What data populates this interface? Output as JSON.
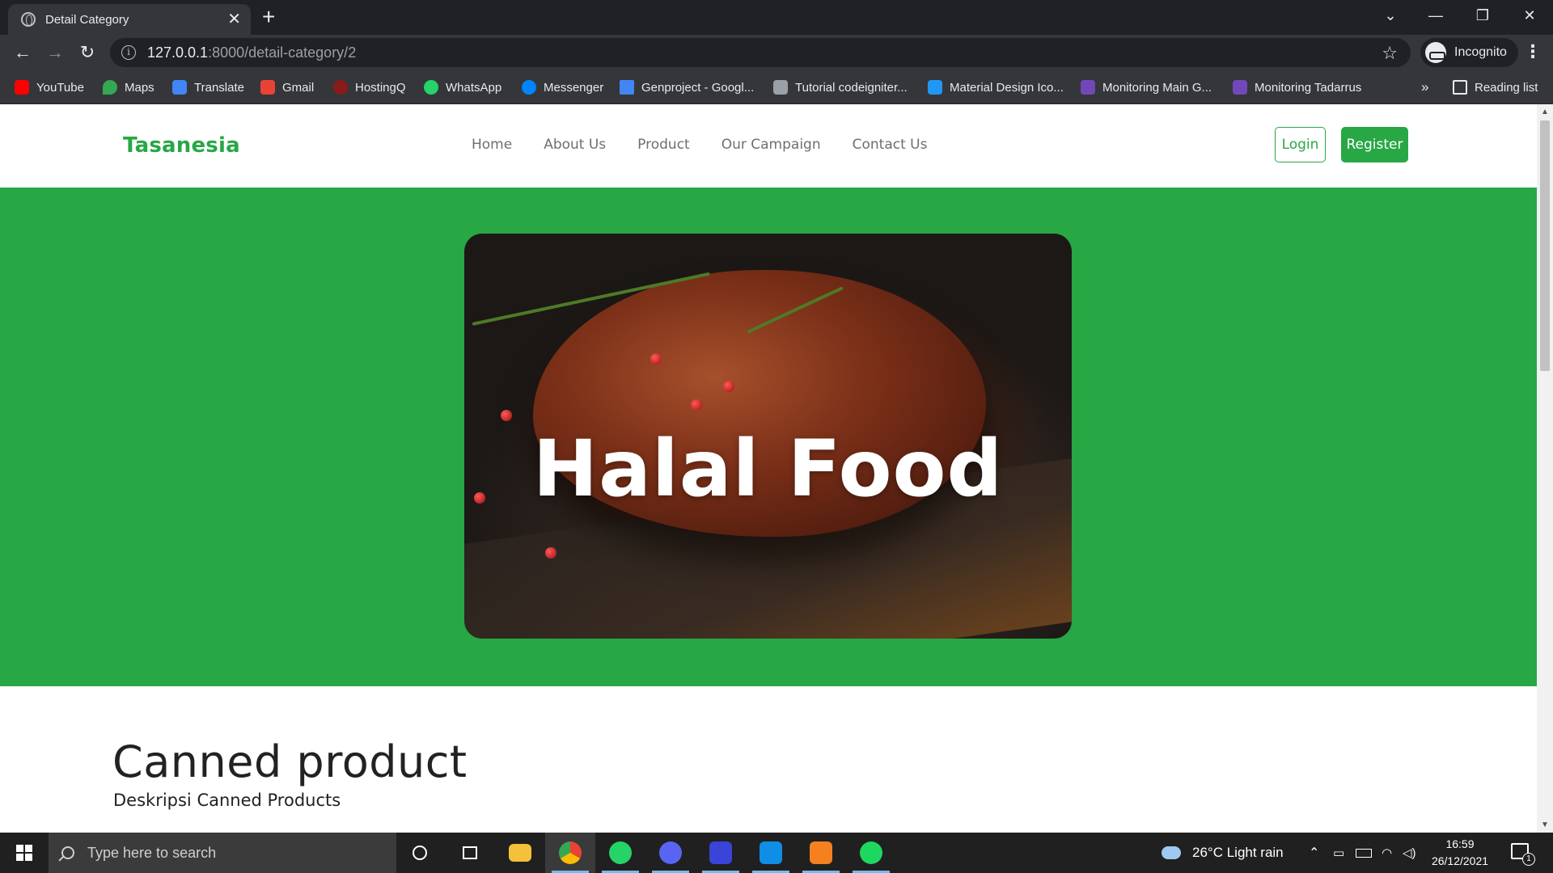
{
  "browser": {
    "tab_title": "Detail Category",
    "url_host": "127.0.0.1",
    "url_path": ":8000/detail-category/2",
    "profile_label": "Incognito",
    "bookmarks": [
      {
        "label": "YouTube",
        "icon": "youtube-icon",
        "color": "#ff0000"
      },
      {
        "label": "Maps",
        "icon": "maps-icon",
        "color": "#34a853"
      },
      {
        "label": "Translate",
        "icon": "translate-icon",
        "color": "#4285f4"
      },
      {
        "label": "Gmail",
        "icon": "gmail-icon",
        "color": "#ea4335"
      },
      {
        "label": "HostingQ",
        "icon": "hostingq-icon",
        "color": "#8b1a1a"
      },
      {
        "label": "WhatsApp",
        "icon": "whatsapp-icon",
        "color": "#25d366"
      },
      {
        "label": "Messenger",
        "icon": "messenger-icon",
        "color": "#0084ff"
      },
      {
        "label": "Genproject - Googl...",
        "icon": "google-docs-icon",
        "color": "#4285f4"
      },
      {
        "label": "Tutorial codeigniter...",
        "icon": "codeigniter-icon",
        "color": "#9aa0a6"
      },
      {
        "label": "Material Design Ico...",
        "icon": "material-design-icon",
        "color": "#2196f3"
      },
      {
        "label": "Monitoring Main G...",
        "icon": "forms-icon",
        "color": "#7248b9"
      },
      {
        "label": "Monitoring Tadarrus",
        "icon": "forms-icon",
        "color": "#7248b9"
      }
    ],
    "overflow_label": "»",
    "reading_list_label": "Reading list"
  },
  "site": {
    "brand": "Tasanesia",
    "nav": [
      "Home",
      "About Us",
      "Product",
      "Our Campaign",
      "Contact Us"
    ],
    "login_label": "Login",
    "register_label": "Register",
    "brand_color": "#28a745"
  },
  "hero": {
    "title": "Halal Food"
  },
  "content": {
    "title": "Canned product",
    "description": "Deskripsi Canned Products"
  },
  "taskbar": {
    "search_placeholder": "Type here to search",
    "weather": "26°C  Light rain",
    "time": "16:59",
    "date": "26/12/2021",
    "notification_count": "1"
  }
}
